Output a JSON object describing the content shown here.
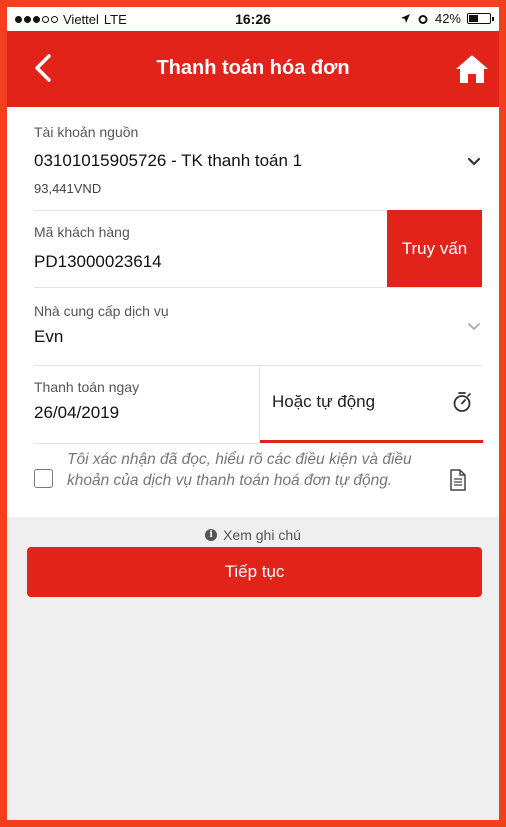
{
  "status_bar": {
    "carrier": "Viettel",
    "network": "LTE",
    "time": "16:26",
    "battery_text": "42%",
    "battery_level": 0.42
  },
  "header": {
    "title": "Thanh toán hóa đơn",
    "back_icon": "chevron-left-icon",
    "home_icon": "home-icon",
    "color": "#e2231a"
  },
  "source_account": {
    "label": "Tài khoản nguồn",
    "value": "03101015905726 - TK thanh toán 1",
    "balance": "93,441VND"
  },
  "customer_code": {
    "label": "Mã khách hàng",
    "value": "PD13000023614",
    "query_button": "Truy vấn"
  },
  "provider": {
    "label": "Nhà cung cấp dịch vụ",
    "value": "Evn"
  },
  "payment_mode": {
    "now_label": "Thanh toán ngay",
    "date": "26/04/2019",
    "auto_label": "Hoặc tự động"
  },
  "terms": {
    "text": "Tôi xác nhận đã đọc, hiểu rõ các điều kiện và điều khoản của dịch vụ thanh toán hoá đơn tự động.",
    "checked": false
  },
  "note_link": "Xem ghi chú",
  "continue_button": "Tiếp tục"
}
